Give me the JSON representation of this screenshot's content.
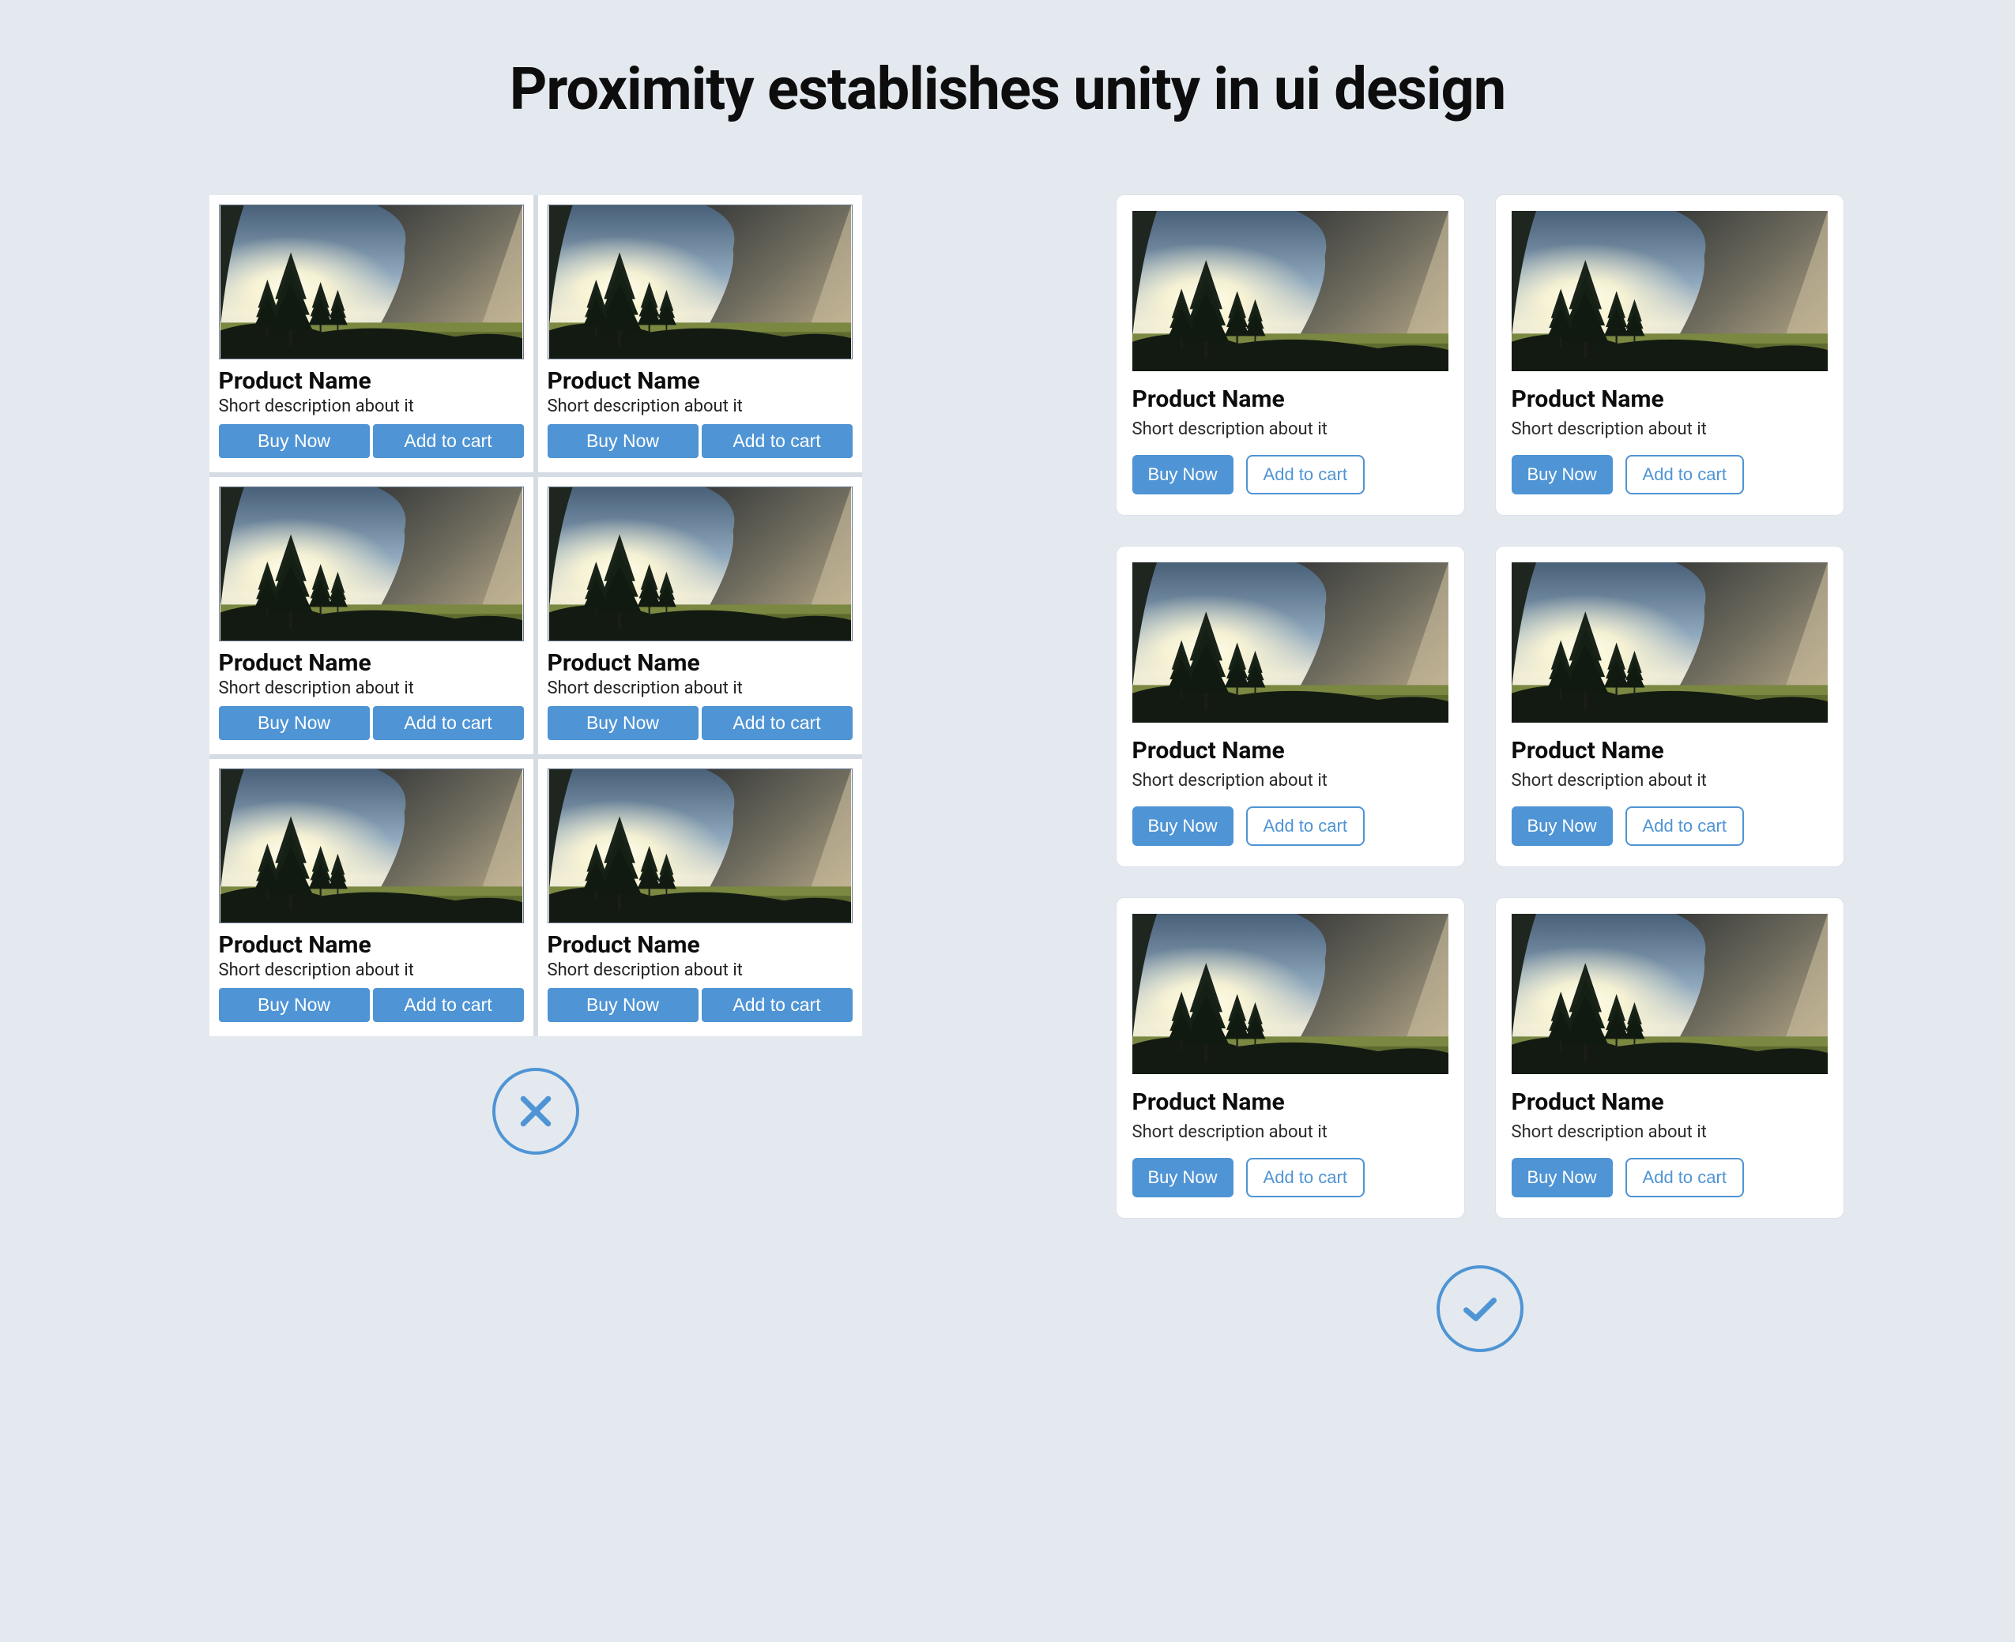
{
  "title": "Proximity establishes unity in ui design",
  "card": {
    "title": "Product Name",
    "desc": "Short description about it",
    "buy": "Buy Now",
    "add": "Add to cart"
  }
}
